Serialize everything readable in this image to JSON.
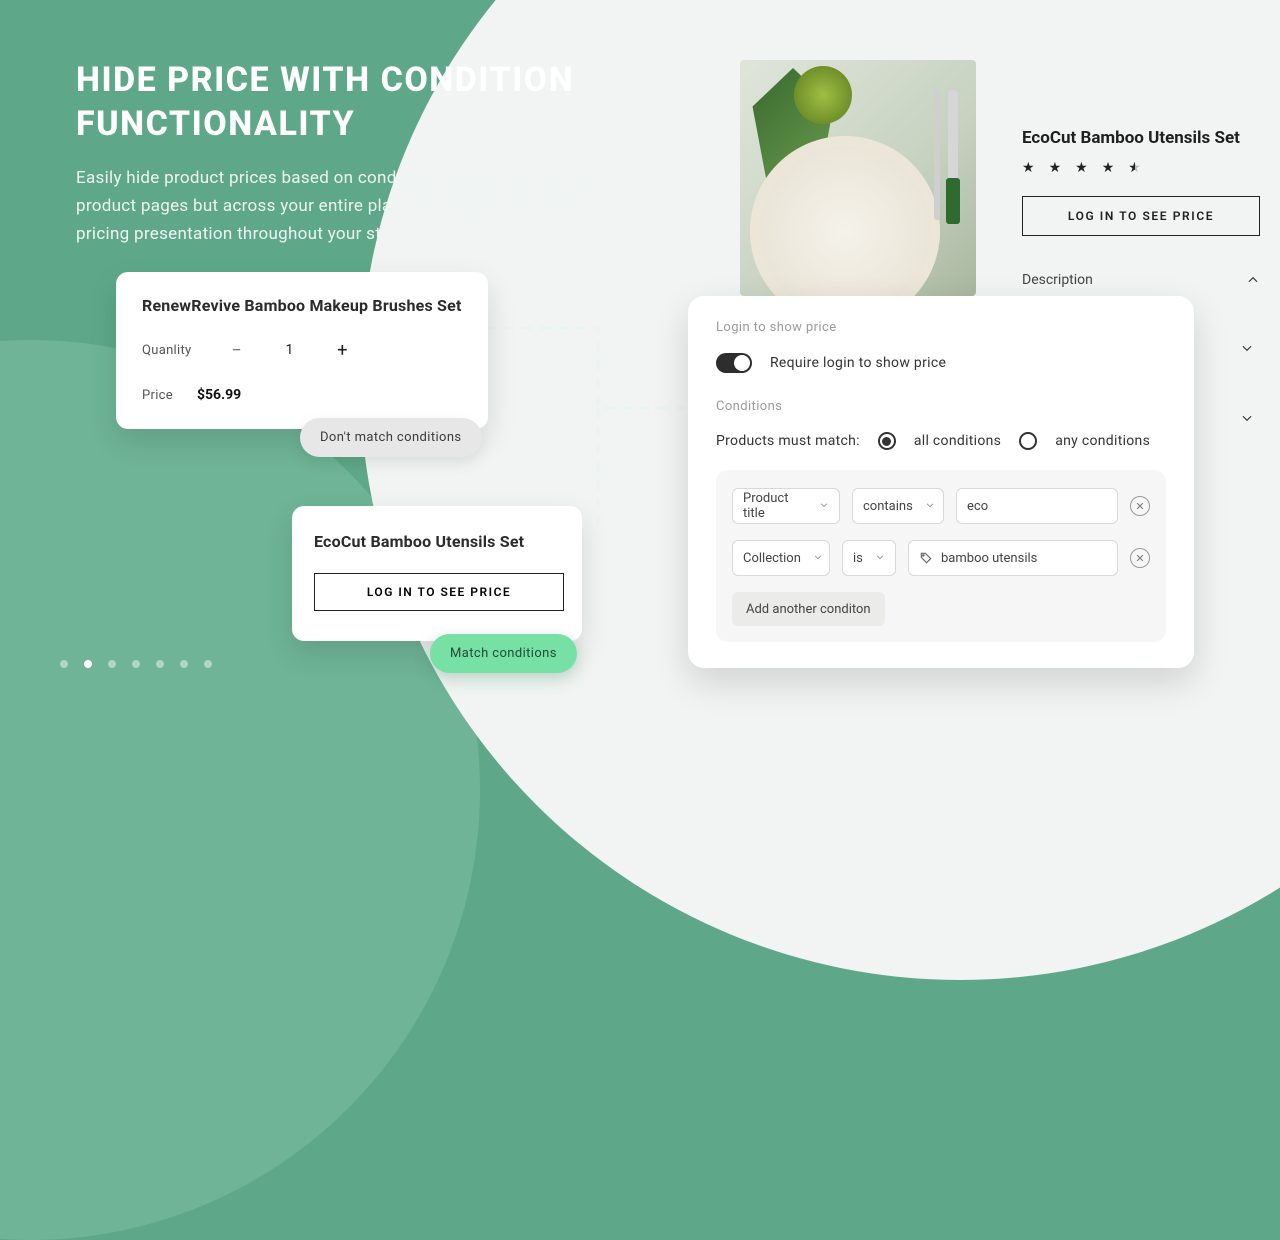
{
  "hero": {
    "title": "HIDE PRICE WITH CONDITION FUNCTIONALITY",
    "desc": "Easily hide product prices based on conditions you set, not just on product pages but across your entire platform, ensure consistent pricing presentation throughout your store."
  },
  "carousel": {
    "count": 7,
    "active_index": 1
  },
  "card1": {
    "title": "RenewRevive Bamboo Makeup Brushes Set",
    "qty_label": "Quanlity",
    "qty_minus": "−",
    "qty_value": "1",
    "qty_plus": "+",
    "price_label": "Price",
    "price_value": "$56.99"
  },
  "chip_no_match": "Don't match conditions",
  "card2": {
    "title": "EcoCut Bamboo Utensils Set",
    "login_btn": "LOG IN TO SEE PRICE"
  },
  "chip_match": "Match conditions",
  "product": {
    "name": "EcoCut Bamboo Utensils Set",
    "login_btn": "LOG IN TO SEE PRICE",
    "accordion": {
      "description": "Description"
    }
  },
  "panel": {
    "section_login": "Login to show price",
    "toggle_label": "Require login to show price",
    "section_conditions": "Conditions",
    "match_label": "Products must match:",
    "radio_all": "all conditions",
    "radio_any": "any conditions",
    "rows": [
      {
        "field": "Product title",
        "op": "contains",
        "value": "eco",
        "tag": false
      },
      {
        "field": "Collection",
        "op": "is",
        "value": "bamboo utensils",
        "tag": true
      }
    ],
    "add_btn": "Add another conditon"
  }
}
